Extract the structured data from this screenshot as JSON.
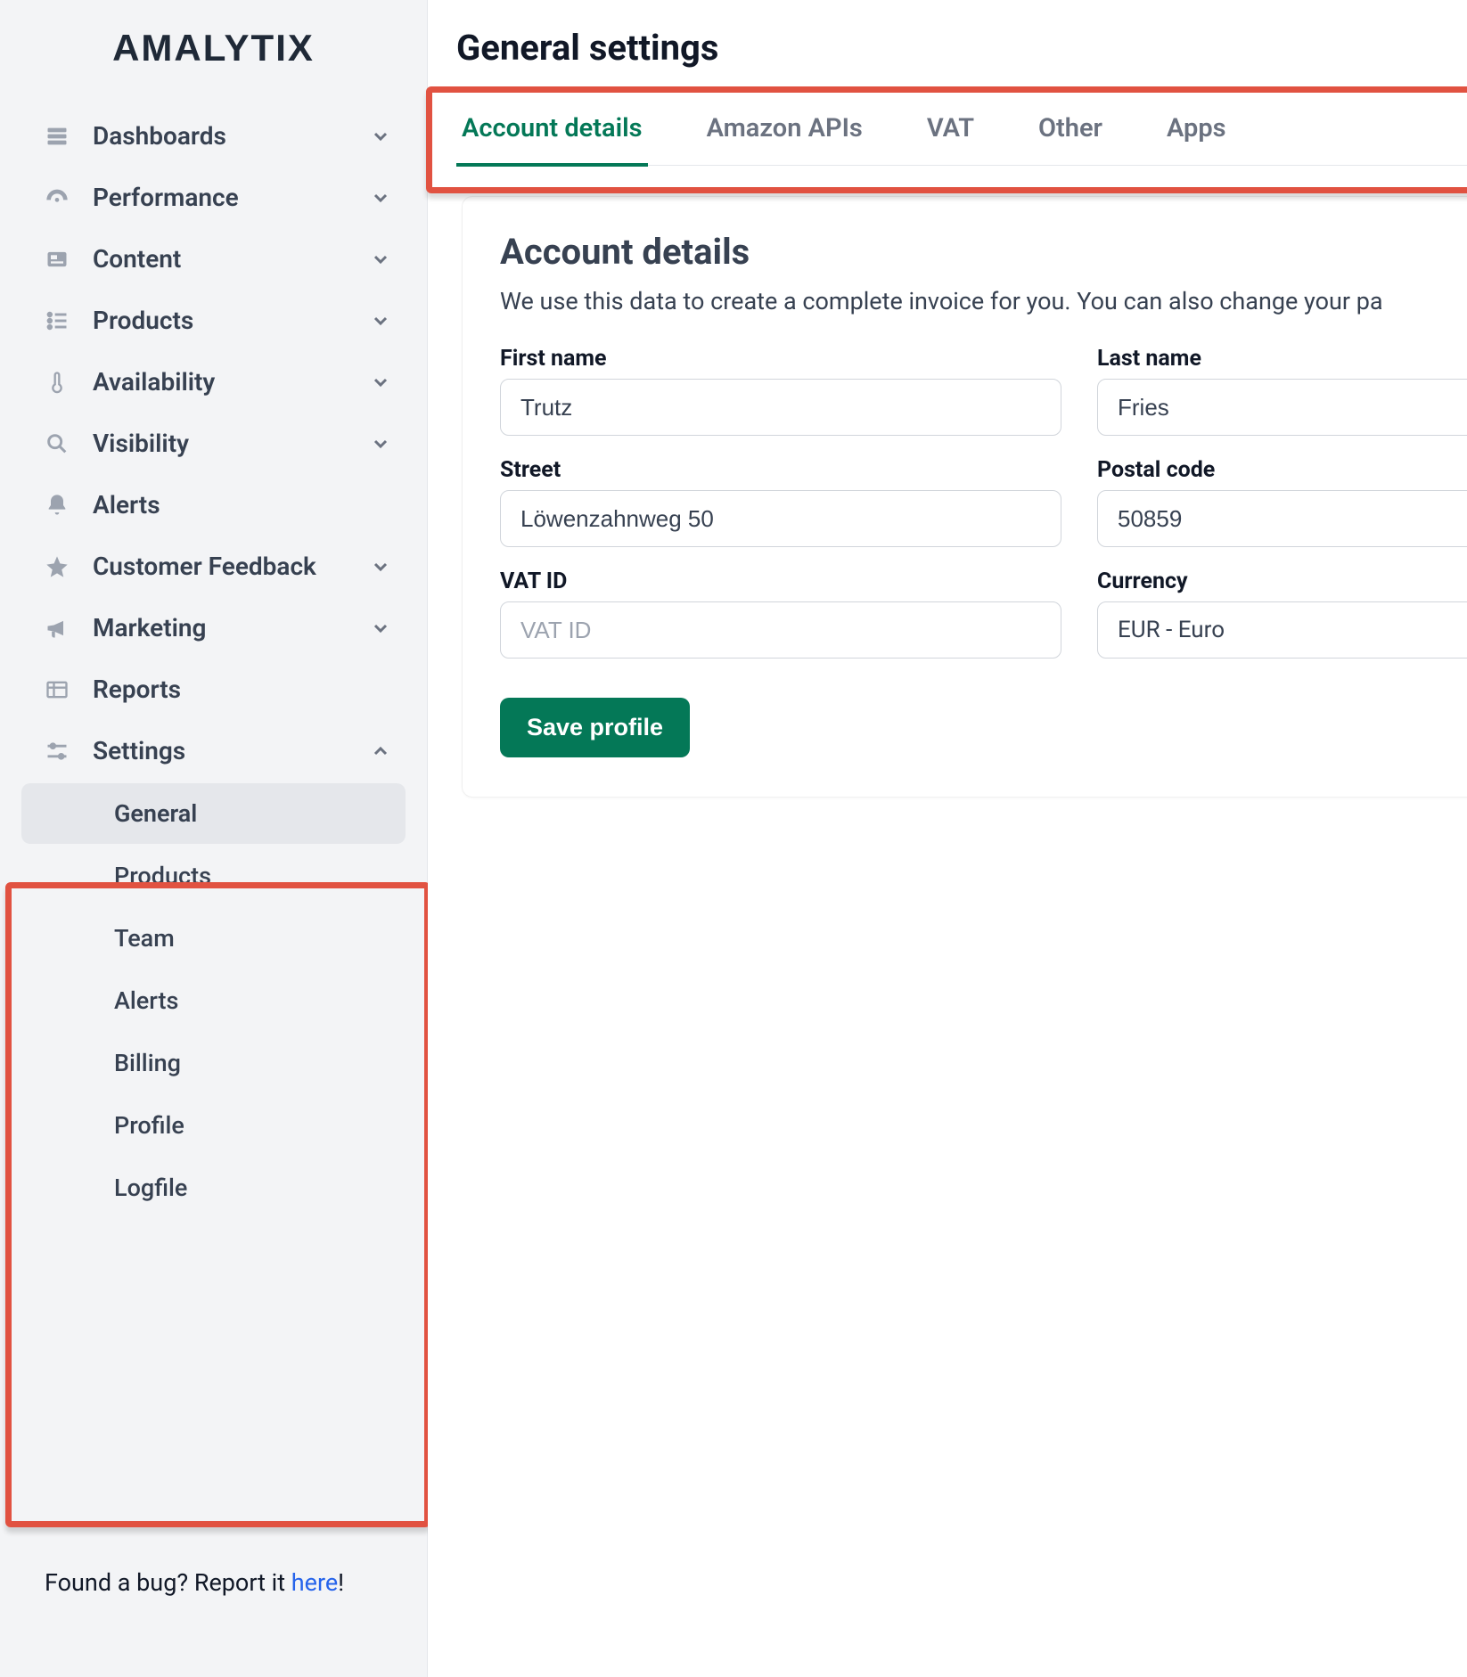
{
  "brand": "AMALYTIX",
  "sidebar": {
    "items": [
      {
        "label": "Dashboards",
        "icon": "dashboard-icon",
        "expandable": true
      },
      {
        "label": "Performance",
        "icon": "gauge-icon",
        "expandable": true
      },
      {
        "label": "Content",
        "icon": "content-icon",
        "expandable": true
      },
      {
        "label": "Products",
        "icon": "list-icon",
        "expandable": true
      },
      {
        "label": "Availability",
        "icon": "thermometer-icon",
        "expandable": true
      },
      {
        "label": "Visibility",
        "icon": "search-icon",
        "expandable": true
      },
      {
        "label": "Alerts",
        "icon": "bell-icon",
        "expandable": false
      },
      {
        "label": "Customer Feedback",
        "icon": "star-icon",
        "expandable": true
      },
      {
        "label": "Marketing",
        "icon": "megaphone-icon",
        "expandable": true
      },
      {
        "label": "Reports",
        "icon": "table-icon",
        "expandable": false
      },
      {
        "label": "Settings",
        "icon": "sliders-icon",
        "expandable": true
      }
    ],
    "settings_sub": [
      {
        "label": "General",
        "active": true
      },
      {
        "label": "Products",
        "active": false
      },
      {
        "label": "Team",
        "active": false
      },
      {
        "label": "Alerts",
        "active": false
      },
      {
        "label": "Billing",
        "active": false
      },
      {
        "label": "Profile",
        "active": false
      },
      {
        "label": "Logfile",
        "active": false
      }
    ],
    "bug_prefix": "Found a bug? Report it ",
    "bug_link": "here",
    "bug_suffix": "!"
  },
  "main": {
    "page_title": "General settings",
    "tabs": [
      {
        "label": "Account details",
        "active": true
      },
      {
        "label": "Amazon APIs",
        "active": false
      },
      {
        "label": "VAT",
        "active": false
      },
      {
        "label": "Other",
        "active": false
      },
      {
        "label": "Apps",
        "active": false
      }
    ],
    "card": {
      "title": "Account details",
      "description": "We use this data to create a complete invoice for you. You can also change your pa",
      "fields": {
        "first_name": {
          "label": "First name",
          "value": "Trutz"
        },
        "last_name": {
          "label": "Last name",
          "value": "Fries"
        },
        "street": {
          "label": "Street",
          "value": "Löwenzahnweg 50"
        },
        "postal_code": {
          "label": "Postal code",
          "value": "50859"
        },
        "vat_id": {
          "label": "VAT ID",
          "value": "",
          "placeholder": "VAT ID"
        },
        "currency": {
          "label": "Currency",
          "value": "EUR - Euro"
        }
      },
      "save_label": "Save profile"
    }
  },
  "colors": {
    "accent": "#047857",
    "highlight": "#e15241"
  }
}
